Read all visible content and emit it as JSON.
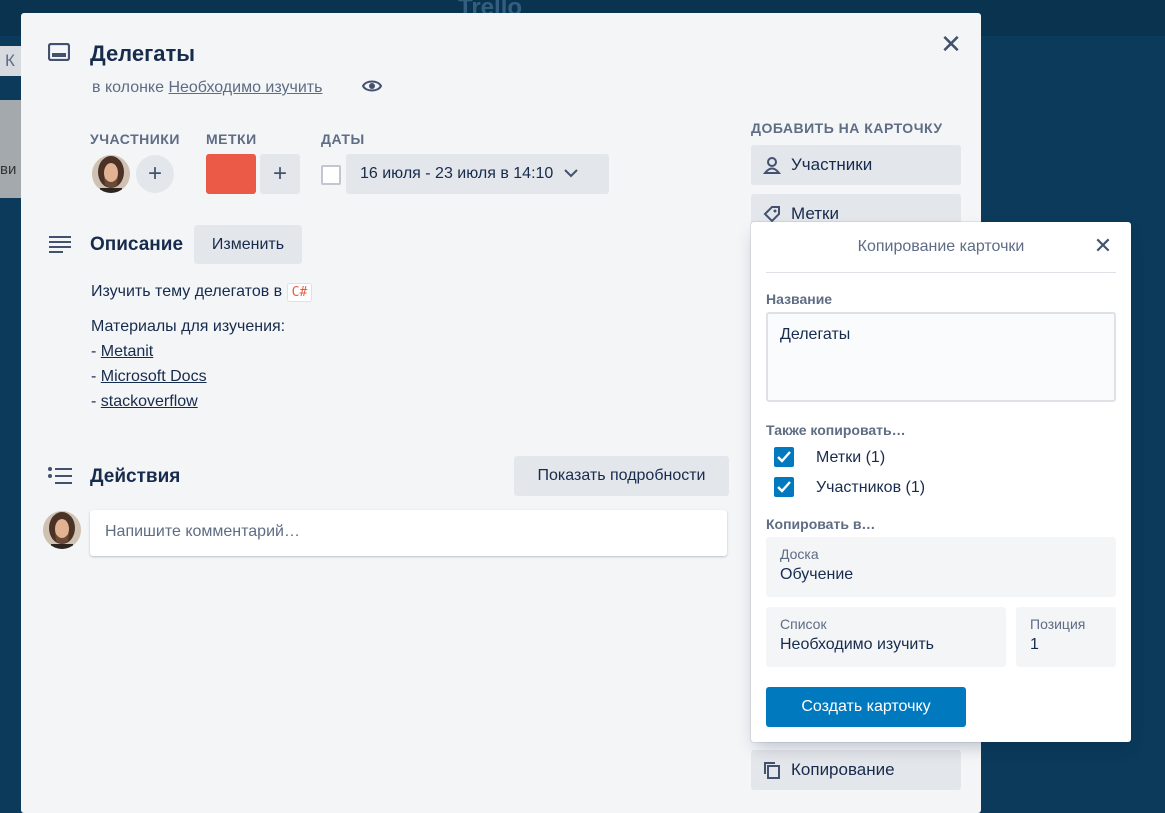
{
  "background": {
    "logo_text": "Trello",
    "left_fragment_top": "К",
    "left_fragment_mid": "ви"
  },
  "card": {
    "title": "Делегаты",
    "in_column_prefix": "в колонке",
    "column_name": "Необходимо изучить",
    "members_label": "УЧАСТНИКИ",
    "labels_label": "МЕТКИ",
    "dates_label": "ДАТЫ",
    "date_range": "16 июля - 23 июля в 14:10",
    "label_color": "#eb5a46",
    "description_title": "Описание",
    "edit_button": "Изменить",
    "description_line1": "Изучить тему делегатов в",
    "description_code": "C#",
    "materials_title": "Материалы для изучения:",
    "links": [
      {
        "prefix": "- ",
        "text": "Metanit"
      },
      {
        "prefix": "- ",
        "text": "Microsoft Docs"
      },
      {
        "prefix": "- ",
        "text": "stackoverflow"
      }
    ],
    "actions_title": "Действия",
    "show_details_button": "Показать подробности",
    "comment_placeholder": "Напишите комментарий…"
  },
  "sidebar": {
    "heading": "ДОБАВИТЬ НА КАРТОЧКУ",
    "members_button": "Участники",
    "labels_button": "Метки",
    "copy_button": "Копирование"
  },
  "copy_popover": {
    "title": "Копирование карточки",
    "name_label": "Название",
    "name_value": "Делегаты",
    "also_copy_label": "Также копировать…",
    "option_labels": "Метки (1)",
    "option_members": "Участников (1)",
    "copy_to_label": "Копировать в…",
    "board_label": "Доска",
    "board_value": "Обучение",
    "list_label": "Список",
    "list_value": "Необходимо изучить",
    "position_label": "Позиция",
    "position_value": "1",
    "create_button": "Создать карточку",
    "accent_color": "#0079bf"
  }
}
